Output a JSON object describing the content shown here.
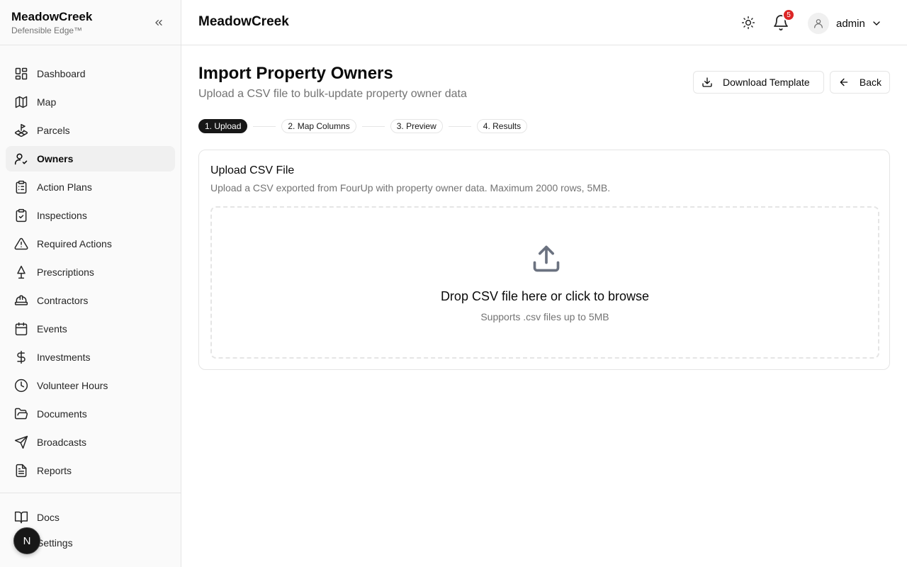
{
  "sidebar": {
    "brand": "MeadowCreek",
    "tagline": "Defensible Edge™",
    "items": [
      {
        "label": "Dashboard",
        "icon": "layout-dashboard-icon"
      },
      {
        "label": "Map",
        "icon": "map-icon"
      },
      {
        "label": "Parcels",
        "icon": "land-plot-icon"
      },
      {
        "label": "Owners",
        "icon": "user-check-icon",
        "active": true
      },
      {
        "label": "Action Plans",
        "icon": "clipboard-list-icon"
      },
      {
        "label": "Inspections",
        "icon": "clipboard-check-icon"
      },
      {
        "label": "Required Actions",
        "icon": "alert-triangle-icon"
      },
      {
        "label": "Prescriptions",
        "icon": "tree-icon"
      },
      {
        "label": "Contractors",
        "icon": "hard-hat-icon"
      },
      {
        "label": "Events",
        "icon": "calendar-icon"
      },
      {
        "label": "Investments",
        "icon": "dollar-sign-icon"
      },
      {
        "label": "Volunteer Hours",
        "icon": "clock-icon"
      },
      {
        "label": "Documents",
        "icon": "folder-open-icon"
      },
      {
        "label": "Broadcasts",
        "icon": "send-icon"
      },
      {
        "label": "Reports",
        "icon": "file-text-icon"
      }
    ],
    "bottom_items": [
      {
        "label": "Docs",
        "icon": "book-open-icon"
      },
      {
        "label": "Settings",
        "icon": "settings-icon"
      }
    ],
    "floating_avatar": "N"
  },
  "topbar": {
    "title": "MeadowCreek",
    "notification_count": "5",
    "user": "admin"
  },
  "page": {
    "title": "Import Property Owners",
    "subtitle": "Upload a CSV file to bulk-update property owner data",
    "download_label": "Download Template",
    "back_label": "Back"
  },
  "steps": [
    "1. Upload",
    "2. Map Columns",
    "3. Preview",
    "4. Results"
  ],
  "active_step": 0,
  "card": {
    "title": "Upload CSV File",
    "description": "Upload a CSV exported from FourUp with property owner data. Maximum 2000 rows, 5MB.",
    "drop_text": "Drop CSV file here or click to browse",
    "drop_hint": "Supports .csv files up to 5MB"
  },
  "colors": {
    "accent": "#171717",
    "badge": "#dc2626",
    "muted_text": "#737373",
    "border": "#e5e5e5",
    "sidebar_bg": "#fafafa"
  }
}
